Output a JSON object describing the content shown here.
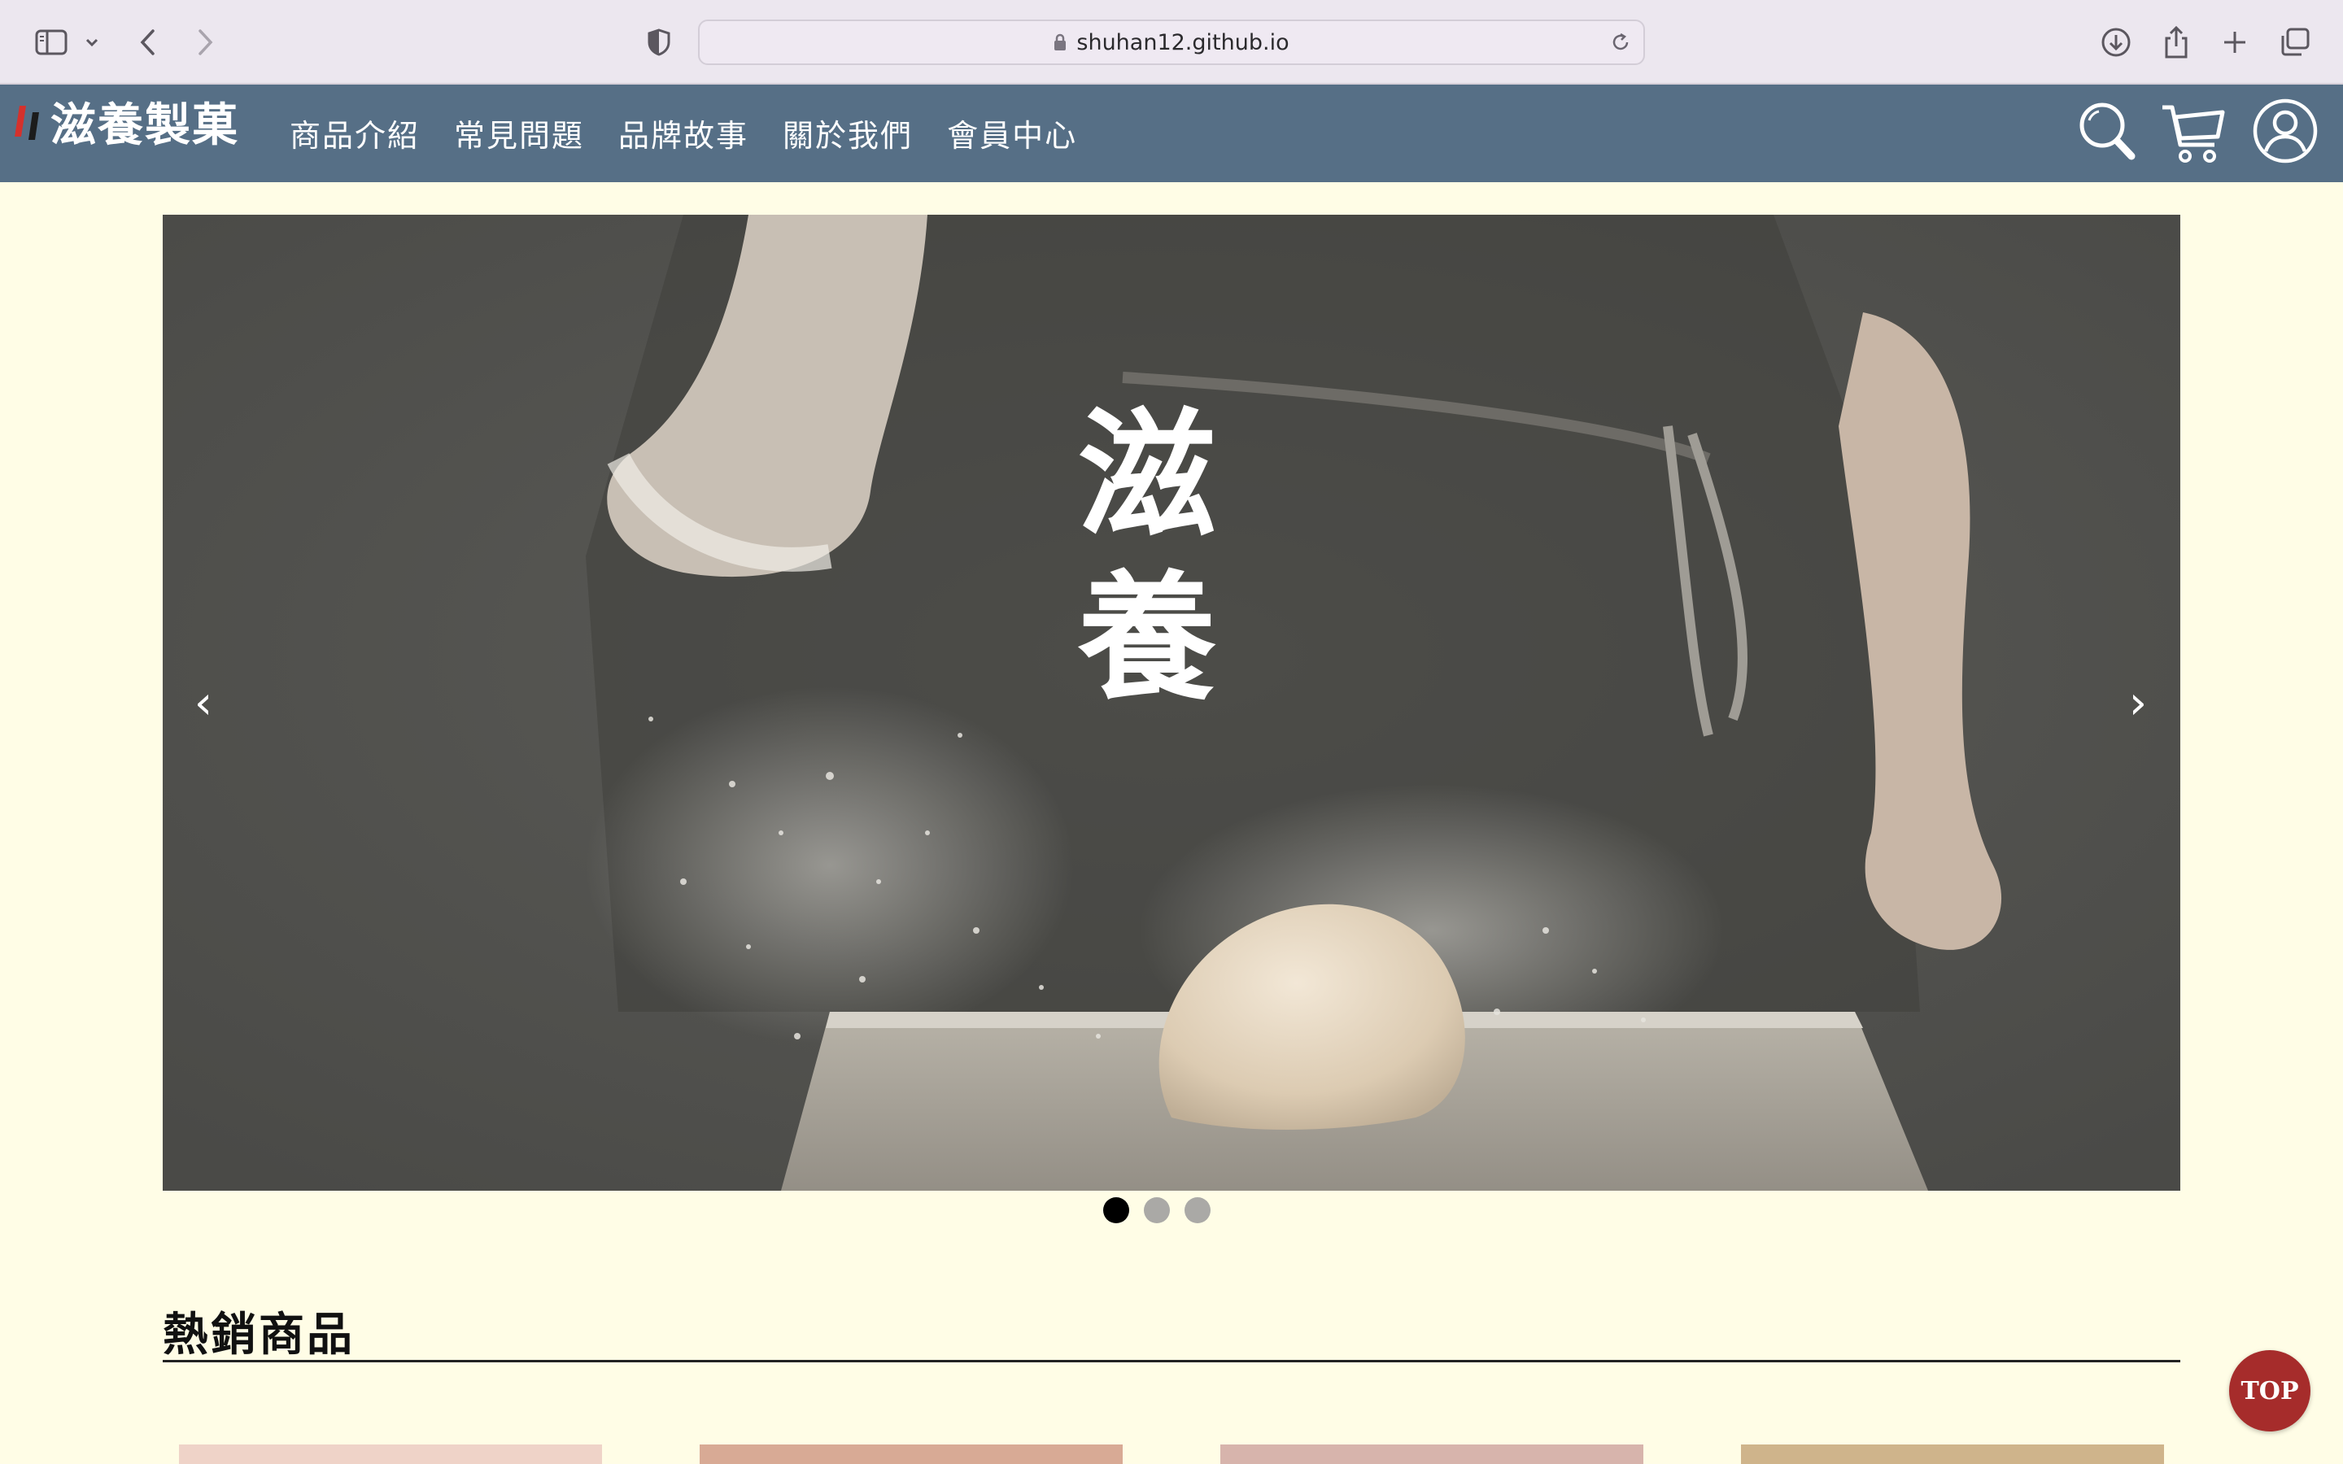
{
  "browser": {
    "url": "shuhan12.github.io"
  },
  "header": {
    "logo_text": "滋養製菓",
    "nav": [
      {
        "label": "商品介紹"
      },
      {
        "label": "常見問題"
      },
      {
        "label": "品牌故事"
      },
      {
        "label": "關於我們"
      },
      {
        "label": "會員中心"
      }
    ],
    "icons": [
      "search-icon",
      "cart-icon",
      "user-icon"
    ],
    "color": "#566f86"
  },
  "carousel": {
    "headline": "滋養",
    "prev_label": "‹",
    "next_label": "›",
    "slide_count": 3,
    "active_slide": 1
  },
  "best_sellers": {
    "title": "熱銷商品",
    "card_colors": [
      "#efd3c8",
      "#d8aa95",
      "#d7b4ac",
      "#cfb48b"
    ]
  },
  "top_button": {
    "label": "TOP",
    "color": "#a62c2b"
  },
  "colors": {
    "page_background": "#fffde6"
  }
}
